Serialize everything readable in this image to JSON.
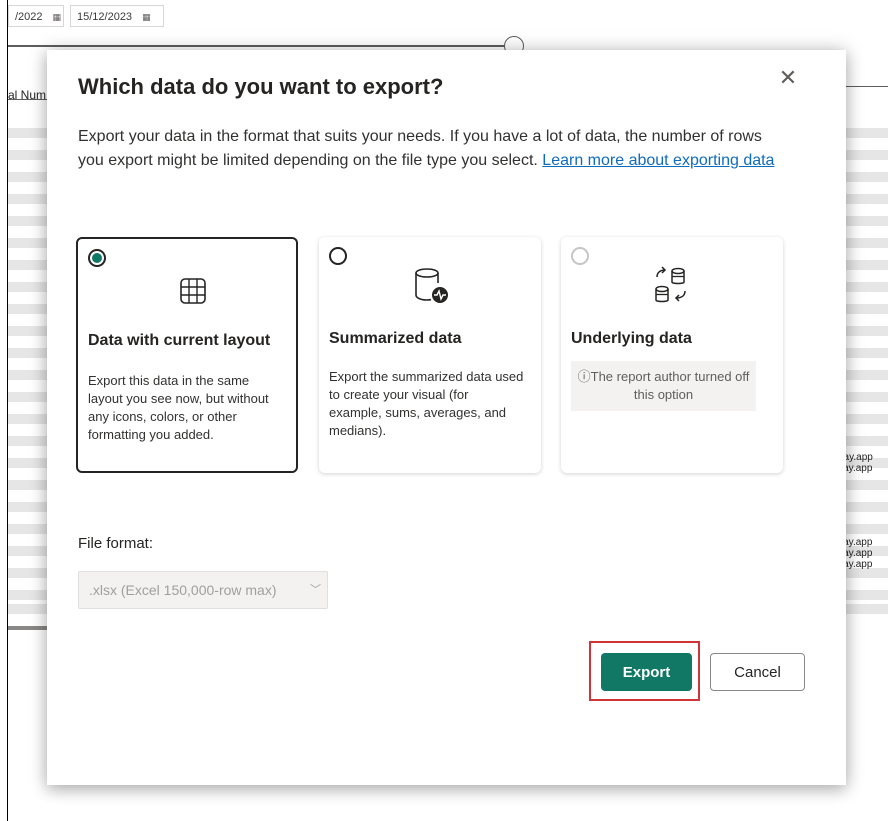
{
  "background": {
    "date_start": "/2022",
    "date_end": "15/12/2023",
    "column_header": "al Num",
    "side_texts": [
      "day.app",
      "eday.app",
      "eday.app",
      "eday.app",
      "eday.app"
    ]
  },
  "dialog": {
    "title": "Which data do you want to export?",
    "close_label": "✕",
    "description": "Export your data in the format that suits your needs. If you have a lot of data, the number of rows you export might be limited depending on the file type you select.",
    "learn_more": "Learn more about exporting data",
    "options": [
      {
        "title": "Data with current layout",
        "description": "Export this data in the same layout you see now, but without any icons, colors, or other formatting you added.",
        "selected": true,
        "icon": "table-grid-icon"
      },
      {
        "title": "Summarized data",
        "description": "Export the summarized data used to create your visual (for example, sums, averages, and medians).",
        "selected": false,
        "icon": "database-pulse-icon"
      },
      {
        "title": "Underlying data",
        "note": "ⓘThe report author turned off this option",
        "selected": false,
        "disabled": true,
        "icon": "database-swap-icon"
      }
    ],
    "file_format_label": "File format:",
    "file_format_value": ".xlsx (Excel 150,000-row max)",
    "export_label": "Export",
    "cancel_label": "Cancel"
  },
  "colors": {
    "accent": "#117865",
    "highlight": "#d13438",
    "link": "#0f6cbd"
  }
}
